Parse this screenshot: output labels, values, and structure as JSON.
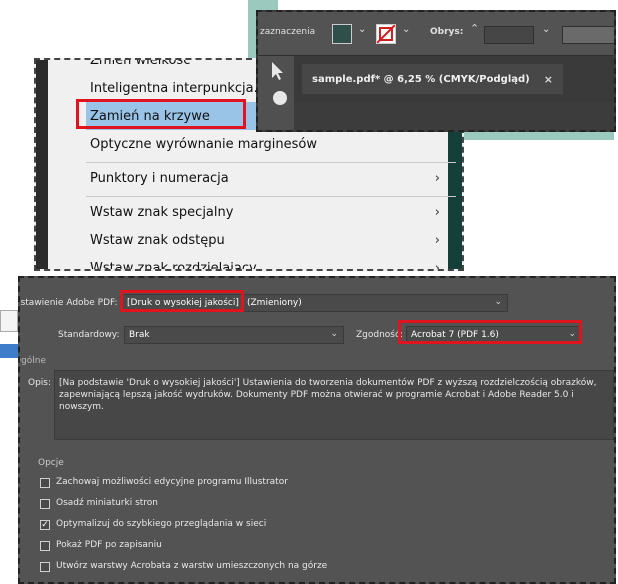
{
  "menu": {
    "partial_top": "Zmień wielkość",
    "items": [
      {
        "label": "Inteligentna interpunkcja...",
        "submenu": false
      },
      {
        "label": "Zamień na krzywe",
        "submenu": false,
        "highlighted": true
      },
      {
        "label": "Optyczne wyrównanie marginesów",
        "submenu": false
      },
      {
        "label": "Punktory i numeracja",
        "submenu": true
      },
      {
        "label": "Wstaw znak specjalny",
        "submenu": true
      },
      {
        "label": "Wstaw znak odstępu",
        "submenu": true
      },
      {
        "label": "Wstaw znak rozdzielający",
        "submenu": true
      }
    ],
    "submenu_arrow": "›"
  },
  "toolbar": {
    "selection_label": "zaznaczenia",
    "stroke_label": "Obrys:",
    "fill_color": "#2f4f4a",
    "doc_tab": "sample.pdf* @ 6,25 % (CMYK/Podgląd)",
    "close_glyph": "×"
  },
  "dialog": {
    "preset_label": "Ustawienie Adobe PDF:",
    "preset_value": "[Druk o wysokiej jakości]",
    "preset_suffix": "(Zmieniony)",
    "standard_label": "Standardowy:",
    "standard_value": "Brak",
    "compat_label": "Zgodność:",
    "compat_value": "Acrobat 7 (PDF 1.6)",
    "general_label": "Ogólne",
    "desc_label": "Opis:",
    "desc_text": "[Na podstawie 'Druk o wysokiej jakości'] Ustawienia do tworzenia dokumentów PDF z wyższą rozdzielczością obrazków, zapewniającą lepszą jakość wydruków. Dokumenty PDF można otwierać w programie Acrobat i Adobe Reader 5.0 i nowszym.",
    "options_label": "Opcje",
    "options": [
      {
        "label": "Zachowaj możliwości edycyjne programu Illustrator",
        "checked": false
      },
      {
        "label": "Osadź miniaturki stron",
        "checked": false
      },
      {
        "label": "Optymalizuj do szybkiego przeglądania w sieci",
        "checked": true
      },
      {
        "label": "Pokaż PDF po zapisaniu",
        "checked": false
      },
      {
        "label": "Utwórz warstwy Acrobata z warstw umieszczonych na górze",
        "checked": false
      }
    ],
    "check_glyph": "✓"
  },
  "colors": {
    "highlight_red": "#e0141e",
    "menu_selection": "#99c4e8",
    "dialog_bg": "#535353"
  }
}
